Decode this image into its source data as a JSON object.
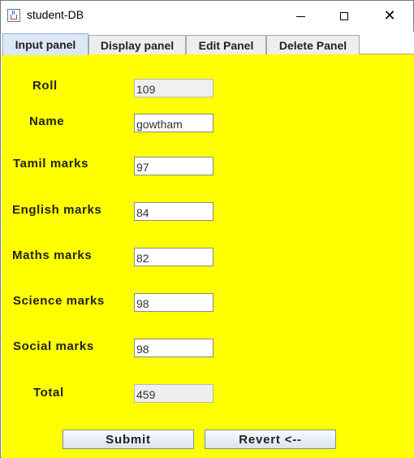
{
  "window": {
    "title": "student-DB",
    "controls": {
      "minimize": "minimize-icon",
      "maximize": "maximize-icon",
      "close": "close-icon"
    }
  },
  "tabs": [
    {
      "label": "Input panel",
      "active": true
    },
    {
      "label": "Display panel",
      "active": false
    },
    {
      "label": "Edit Panel",
      "active": false
    },
    {
      "label": "Delete Panel",
      "active": false
    }
  ],
  "form": {
    "roll": {
      "label": "Roll",
      "value": "109"
    },
    "name": {
      "label": "Name",
      "value": "gowtham"
    },
    "tamil": {
      "label": "Tamil marks",
      "value": "97"
    },
    "english": {
      "label": "English marks",
      "value": "84"
    },
    "maths": {
      "label": "Maths marks",
      "value": "82"
    },
    "science": {
      "label": "Science marks",
      "value": "98"
    },
    "social": {
      "label": "Social marks",
      "value": "98"
    },
    "total": {
      "label": "Total",
      "value": "459"
    }
  },
  "buttons": {
    "submit": "Submit",
    "revert": "Revert <--"
  },
  "colors": {
    "panel_background": "#ffff00",
    "active_tab": "#dce8f5"
  }
}
